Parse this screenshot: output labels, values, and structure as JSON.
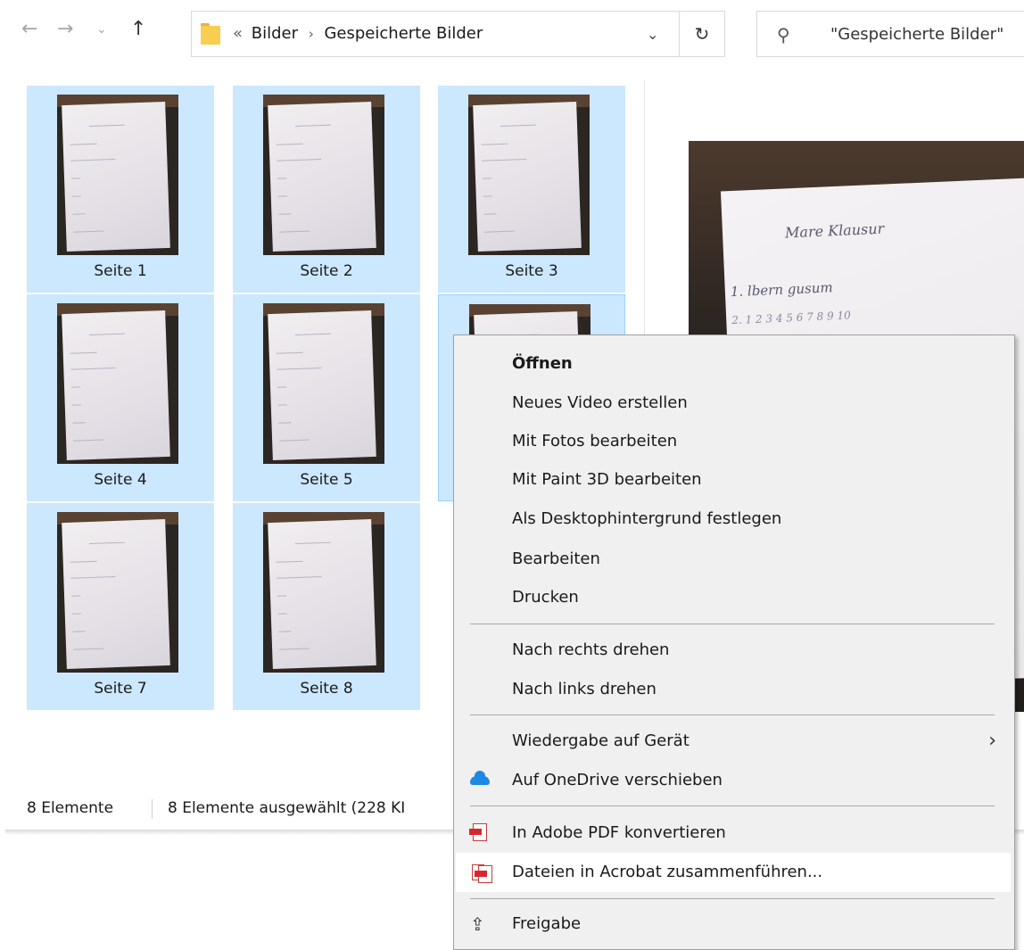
{
  "toolbar": {
    "back_icon": "arrow-left-icon",
    "forward_icon": "arrow-right-icon",
    "recent_icon": "chevron-down-icon",
    "up_icon": "arrow-up-icon",
    "breadcrumb_overflow": "«",
    "breadcrumb": [
      "Bilder",
      "Gespeicherte Bilder"
    ],
    "breadcrumb_separator": "›",
    "dropdown_glyph": "⌄",
    "refresh_glyph": "↻",
    "search_placeholder": "\"Gespeicherte Bilder\""
  },
  "files": [
    {
      "name": "Seite 1"
    },
    {
      "name": "Seite 2"
    },
    {
      "name": "Seite 3"
    },
    {
      "name": "Seite 4"
    },
    {
      "name": "Seite 5"
    },
    {
      "name": ""
    },
    {
      "name": "Seite 7"
    },
    {
      "name": "Seite 8"
    }
  ],
  "preview": {
    "line1": "Mare Klausur",
    "line2": "1. lbern gusum",
    "line3": "2. 1 2 3 4 5 6 7 8 9 10"
  },
  "status": {
    "count": "8 Elemente",
    "selection": "8 Elemente ausgewählt (228 KI"
  },
  "context_menu": {
    "items": [
      {
        "label": "Öffnen",
        "bold": true
      },
      {
        "label": "Neues Video erstellen"
      },
      {
        "label": "Mit Fotos bearbeiten"
      },
      {
        "label": "Mit Paint 3D bearbeiten"
      },
      {
        "label": "Als Desktophintergrund festlegen"
      },
      {
        "label": "Bearbeiten"
      },
      {
        "label": "Drucken"
      },
      {
        "label": "Nach rechts drehen"
      },
      {
        "label": "Nach links drehen"
      },
      {
        "label": "Wiedergabe auf Gerät",
        "submenu_glyph": "›"
      },
      {
        "label": "Auf OneDrive verschieben",
        "icon": "onedrive-icon"
      },
      {
        "label": "In Adobe PDF konvertieren",
        "icon": "adobe-pdf-icon"
      },
      {
        "label": "Dateien in Acrobat zusammenführen...",
        "icon": "acrobat-combine-icon"
      },
      {
        "label": "Freigabe",
        "icon": "share-icon"
      }
    ]
  },
  "colors": {
    "selection": "#cce8ff",
    "menu_bg": "#f0f0f0",
    "onedrive": "#1e88e5",
    "pdf_red": "#d7262c"
  }
}
